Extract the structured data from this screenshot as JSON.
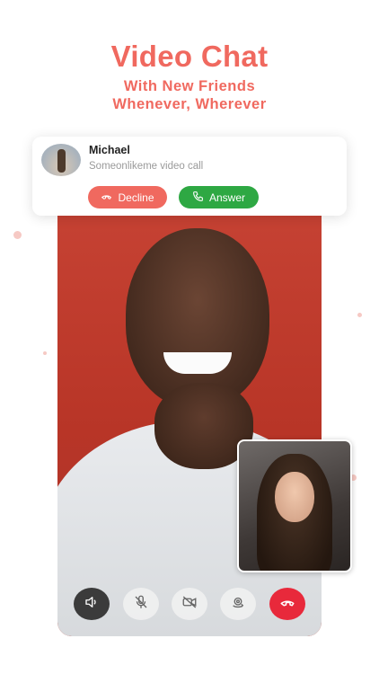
{
  "headline": {
    "title": "Video Chat",
    "line1": "With New Friends",
    "line2": "Whenever, Wherever"
  },
  "incoming_call": {
    "caller_name": "Michael",
    "subtitle": "Someonlikeme video call",
    "decline_label": "Decline",
    "answer_label": "Answer"
  },
  "controls": [
    {
      "icon": "speaker-icon"
    },
    {
      "icon": "mic-off-icon"
    },
    {
      "icon": "camera-off-icon"
    },
    {
      "icon": "switch-camera-icon"
    },
    {
      "icon": "end-call-icon"
    }
  ],
  "colors": {
    "accent": "#f0695f",
    "answer": "#2ea843",
    "end_call": "#e8293b"
  }
}
